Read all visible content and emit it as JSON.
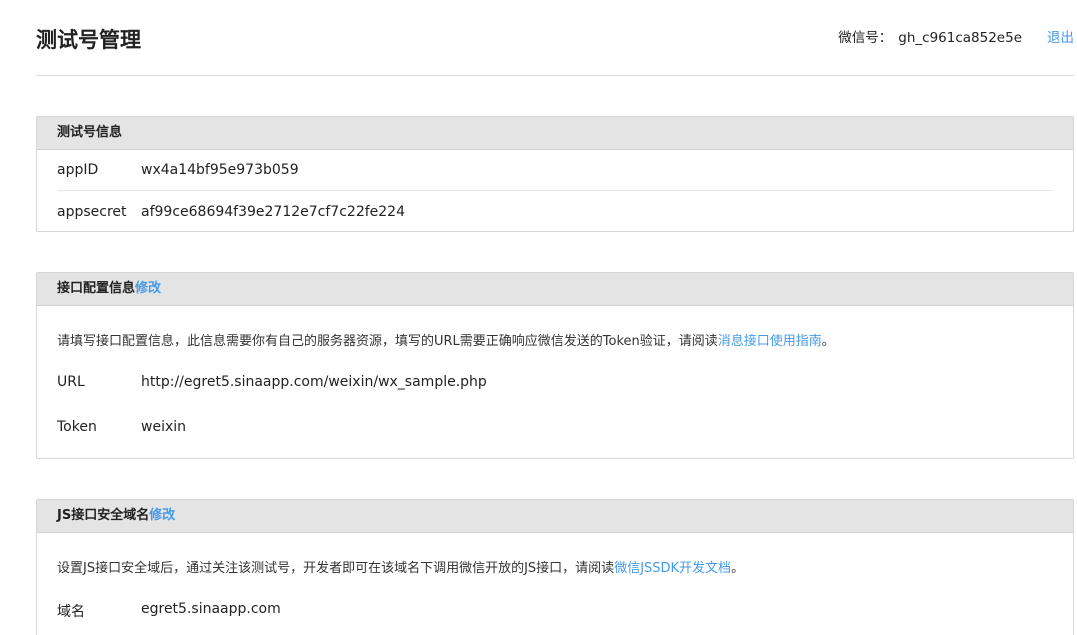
{
  "header": {
    "title": "测试号管理",
    "wechat_label": "微信号：",
    "wechat_id": "gh_c961ca852e5e",
    "logout_label": "退出"
  },
  "test_account": {
    "heading": "测试号信息",
    "appid_label": "appID",
    "appid_value": "wx4a14bf95e973b059",
    "appsecret_label": "appsecret",
    "appsecret_value": "af99ce68694f39e2712e7cf7c22fe224"
  },
  "interface_config": {
    "heading": "接口配置信息",
    "edit_label": "修改",
    "description": "请填写接口配置信息，此信息需要你有自己的服务器资源，填写的URL需要正确响应微信发送的Token验证，请阅读",
    "guide_link": "消息接口使用指南",
    "description_end": "。",
    "url_label": "URL",
    "url_value": "http://egret5.sinaapp.com/weixin/wx_sample.php",
    "token_label": "Token",
    "token_value": "weixin"
  },
  "js_domain": {
    "heading": "JS接口安全域名",
    "edit_label": "修改",
    "description": "设置JS接口安全域后，通过关注该测试号，开发者即可在该域名下调用微信开放的JS接口，请阅读",
    "doc_link": "微信JSSDK开发文档",
    "description_end": "。",
    "domain_label": "域名",
    "domain_value": "egret5.sinaapp.com"
  }
}
